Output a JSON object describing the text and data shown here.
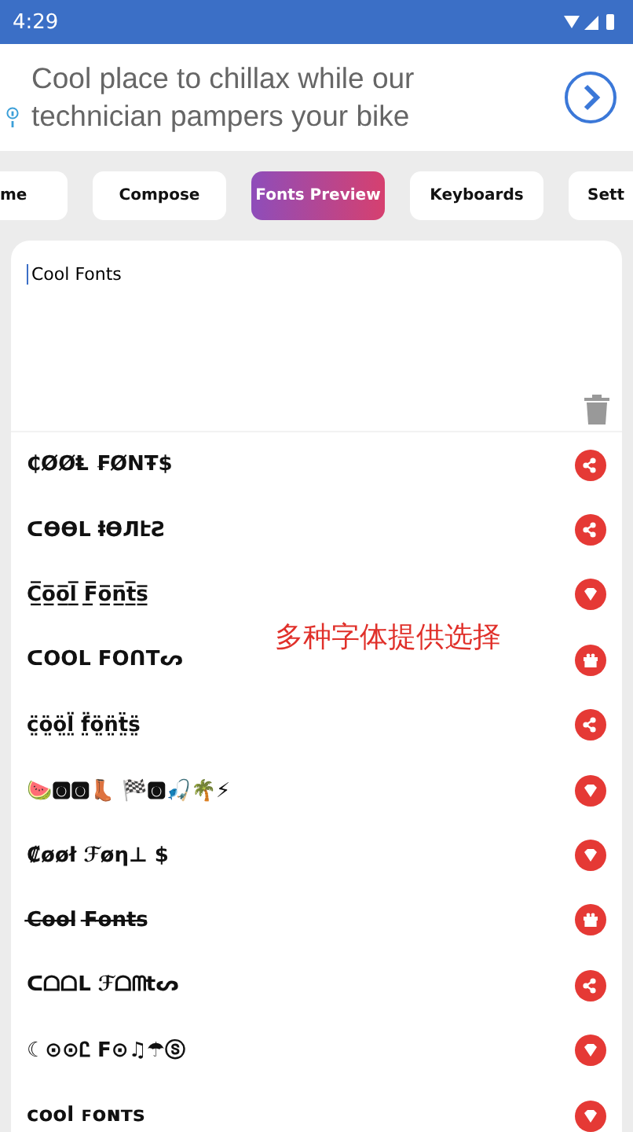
{
  "status_bar": {
    "time": "4:29"
  },
  "ad": {
    "text": "Cool place to chillax while our technician pampers your bike"
  },
  "tabs": [
    {
      "label": "me",
      "selected": false
    },
    {
      "label": "Compose",
      "selected": false
    },
    {
      "label": "Fonts Preview",
      "selected": true
    },
    {
      "label": "Keyboards",
      "selected": false
    },
    {
      "label": "Sett",
      "selected": false
    }
  ],
  "editor": {
    "value": "Cool Fonts"
  },
  "caption": "多种字体提供选择",
  "fonts": [
    {
      "sample": "₵ØØⱠ ₣ØNŦ$",
      "kind": "share"
    },
    {
      "sample": "ᑕƟƟᒪ ⱡƟЛէƧ",
      "kind": "share"
    },
    {
      "sample": "C̲̅o̲̅o̲̅l̲̅ F̲̅o̲̅n̲̅t̲̅s̲̅",
      "kind": "diamond"
    },
    {
      "sample": "ᑕOOᒪ FOᑎTᔕ",
      "kind": "gift"
    },
    {
      "sample": "c̤̈ö̤ö̤l̤̈ f̤̈ö̤n̤̈ẗ̤s̤̈",
      "kind": "share"
    },
    {
      "sample": "🍉🅾🅾👢 🏁🅾🎣🌴⚡",
      "kind": "diamond"
    },
    {
      "sample": "₡øøł ℱøη⊥ $",
      "kind": "diamond"
    },
    {
      "sample": "C̶o̶o̶l̶ F̶o̶n̶t̶s̶",
      "kind": "gift"
    },
    {
      "sample": "ᑕᗝᗝL ℱᗝᗰtᔕ",
      "kind": "share"
    },
    {
      "sample": "☾⊙⊙Ꮭ F⊙♫☂ⓢ",
      "kind": "diamond"
    },
    {
      "sample": "cool ꜰᴏɴᴛꜱ",
      "kind": "diamond"
    }
  ]
}
